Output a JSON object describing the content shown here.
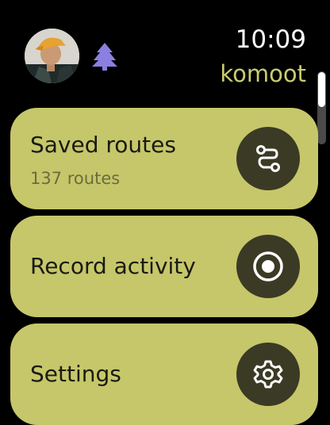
{
  "status": {
    "time": "10:09",
    "brand": "komoot"
  },
  "menu": [
    {
      "title": "Saved routes",
      "subtitle": "137 routes",
      "icon": "route-icon"
    },
    {
      "title": "Record activity",
      "icon": "record-icon"
    },
    {
      "title": "Settings",
      "icon": "gear-icon"
    }
  ],
  "colors": {
    "accent": "#c6c76a",
    "iconCircle": "#3b3a25",
    "brandText": "#c9cd6e",
    "tree": "#8b7fe0"
  }
}
